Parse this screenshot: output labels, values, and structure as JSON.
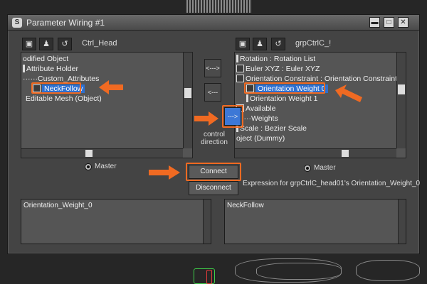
{
  "window": {
    "title": "Parameter Wiring #1",
    "icon": "max-app-icon"
  },
  "left_panel": {
    "object_label": "Ctrl_Head",
    "tree": [
      "odified Object",
      "Attribute Holder",
      "Custom_Attributes",
      "NeckFollow",
      "Editable Mesh (Object)"
    ],
    "selected_index": 3,
    "radio_label": "Master"
  },
  "right_panel": {
    "object_label": "grpCtrlC_!",
    "tree": [
      "Rotation : Rotation List",
      "Euler XYZ : Euler XYZ",
      "Orientation Constraint : Orientation Constraint",
      "Orientation Weight 0",
      "Orientation Weight 1",
      "Available",
      "Weights",
      "Scale : Bezier Scale",
      "oject (Dummy)"
    ],
    "selected_index": 3,
    "radio_label": "Master"
  },
  "direction": {
    "btn_both": "<--->",
    "btn_left": "<---",
    "btn_right": "--->",
    "caption_line1": "control",
    "caption_line2": "direction",
    "active": "right"
  },
  "actions": {
    "connect": "Connect",
    "disconnect": "Disconnect",
    "expression_label": "Expression for grpCtrlC_head01's Orientation_Weight_0"
  },
  "expressions": {
    "left": "Orientation_Weight_0",
    "right": "NeckFollow"
  },
  "colors": {
    "accent": "#2d6fd0",
    "highlight": "#f06a22",
    "background": "#444444"
  }
}
